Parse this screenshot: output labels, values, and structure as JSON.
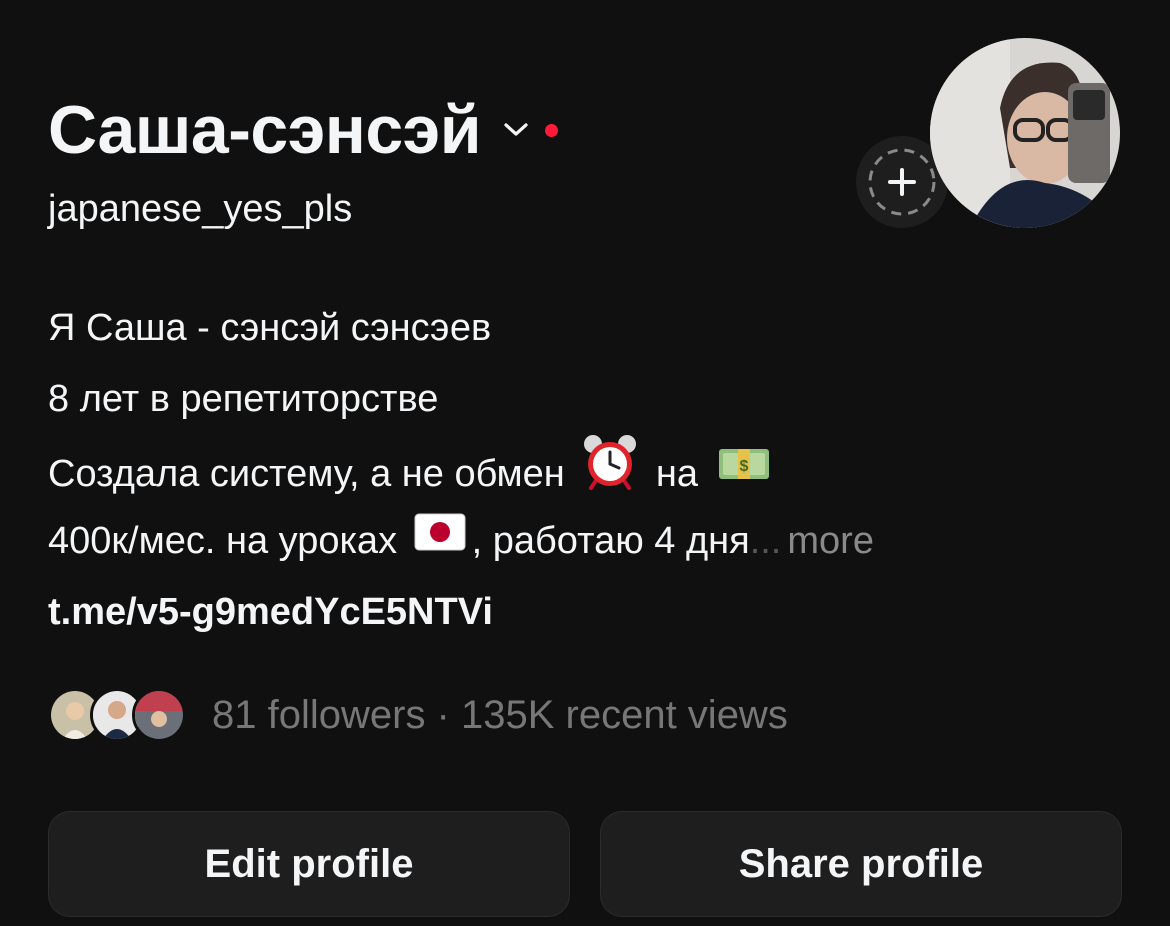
{
  "profile": {
    "display_name": "Саша-сэнсэй",
    "username": "japanese_yes_pls",
    "status_dot_color": "#ff1a3a"
  },
  "bio": {
    "line1": "Я Саша - сэнсэй сэнсэев",
    "line2": "8 лет в репетиторстве",
    "line3_a": "Создала систему, а не обмен",
    "line3_b": "на",
    "line4_a": "400к/мес. на уроках",
    "line4_b": ", работаю 4 дня",
    "ellipsis": "...",
    "more": "more",
    "link": "t.me/v5-g9medYcE5NTVi"
  },
  "stats": {
    "text": "81 followers · 135K recent views"
  },
  "actions": {
    "edit_label": "Edit profile",
    "share_label": "Share profile"
  },
  "icons": [
    "chevron-down-icon",
    "plus-icon",
    "alarm-clock-icon",
    "money-icon",
    "japan-flag-icon"
  ]
}
